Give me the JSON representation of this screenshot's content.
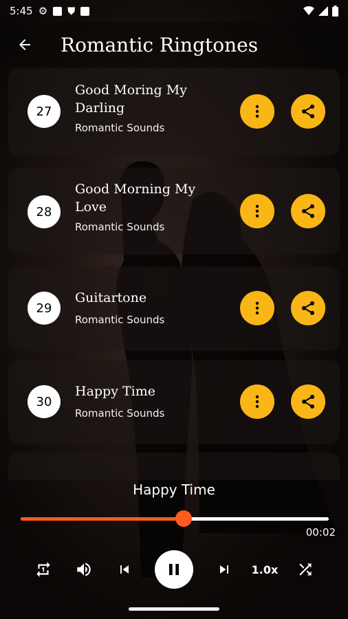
{
  "status_bar": {
    "time": "5:45"
  },
  "app_bar": {
    "title": "Romantic Ringtones"
  },
  "ringtones": [
    {
      "number": "27",
      "name": "Good Moring My Darling",
      "artist": "Romantic Sounds"
    },
    {
      "number": "28",
      "name": "Good Morning My Love",
      "artist": "Romantic Sounds"
    },
    {
      "number": "29",
      "name": "Guitartone",
      "artist": "Romantic Sounds"
    },
    {
      "number": "30",
      "name": "Happy Time",
      "artist": "Romantic Sounds"
    }
  ],
  "player": {
    "now_playing": "Happy Time",
    "progress_fraction": 0.53,
    "elapsed": "00:02",
    "speed": "1.0x"
  },
  "colors": {
    "accent": "#f9b616",
    "seek": "#ff5a1f"
  },
  "icons": {
    "back": "arrow-left-icon",
    "more": "more-vertical-icon",
    "share": "share-icon",
    "repeat": "repeat-one-icon",
    "volume": "volume-icon",
    "previous": "skip-previous-icon",
    "pause": "pause-icon",
    "next": "skip-next-icon",
    "shuffle": "shuffle-icon"
  }
}
